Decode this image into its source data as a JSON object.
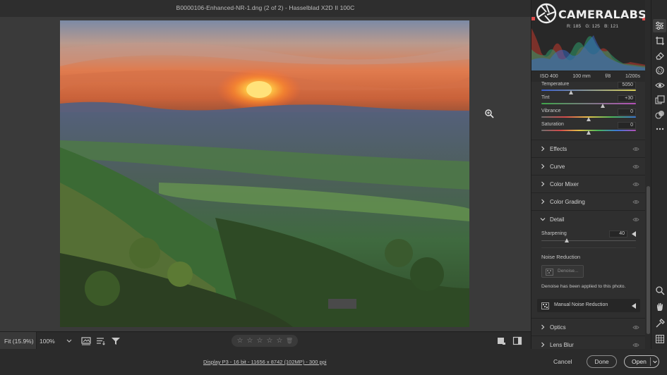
{
  "window": {
    "title": "B0000106-Enhanced-NR-1.dng (2 of 2)  -  Hasselblad X2D II 100C"
  },
  "watermark": {
    "text": "CAMERALABS.COM"
  },
  "histogram": {
    "r_label": "R: 185",
    "g_label": "G: 125",
    "b_label": "B: 121"
  },
  "exif": {
    "iso": "ISO 400",
    "focal": "100 mm",
    "aperture": "f/8",
    "shutter": "1/200s"
  },
  "basic": {
    "temperature": {
      "label": "Temperature",
      "value": "5050",
      "position": 0.31
    },
    "tint": {
      "label": "Tint",
      "value": "+30",
      "position": 0.65
    },
    "vibrance": {
      "label": "Vibrance",
      "value": "0",
      "position": 0.5
    },
    "saturation": {
      "label": "Saturation",
      "value": "0",
      "position": 0.5
    }
  },
  "sections": {
    "effects": "Effects",
    "curve": "Curve",
    "color_mixer": "Color Mixer",
    "color_grading": "Color Grading",
    "detail": "Detail",
    "optics": "Optics",
    "lens_blur": "Lens Blur"
  },
  "detail": {
    "sharpening": {
      "label": "Sharpening",
      "value": "40",
      "position": 0.27
    },
    "noise_reduction_heading": "Noise Reduction",
    "denoise_button": "Denoise...",
    "denoise_note": "Denoise has been applied to this photo.",
    "manual_noise_reduction": "Manual Noise Reduction"
  },
  "toolbar": {
    "zoom_fit": "Fit (15.9%)",
    "zoom_100": "100%",
    "stars": [
      "☆",
      "☆",
      "☆",
      "☆",
      "☆"
    ],
    "delete_glyph": "🗑"
  },
  "status": {
    "info": "Display P3 - 16 bit - 11656 x 8742 (102MP) - 300 ppi",
    "cancel": "Cancel",
    "done": "Done",
    "open": "Open"
  }
}
